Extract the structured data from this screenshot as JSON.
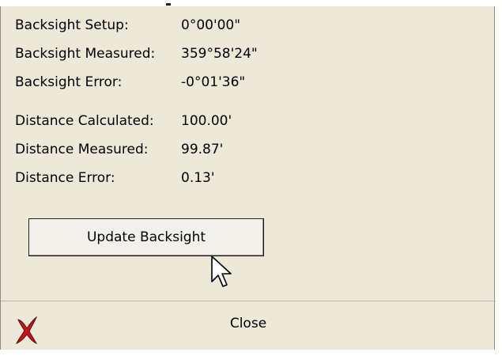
{
  "fields": [
    {
      "label": "Backsight Setup:",
      "value": "0°00'00\""
    },
    {
      "label": "Backsight Measured:",
      "value": "359°58'24\""
    },
    {
      "label": "Backsight Error:",
      "value": "-0°01'36\""
    },
    {
      "label": "Distance Calculated:",
      "value": "100.00'"
    },
    {
      "label": "Distance Measured:",
      "value": "99.87'"
    },
    {
      "label": "Distance Error:",
      "value": "0.13'"
    }
  ],
  "actions": {
    "update_label": "Update Backsight",
    "close_label": "Close"
  },
  "colors": {
    "panel_bg": "#ece9d8",
    "close_icon": "#c8141c"
  },
  "icons": {
    "close": "close-x-icon",
    "cursor": "mouse-pointer-icon"
  }
}
